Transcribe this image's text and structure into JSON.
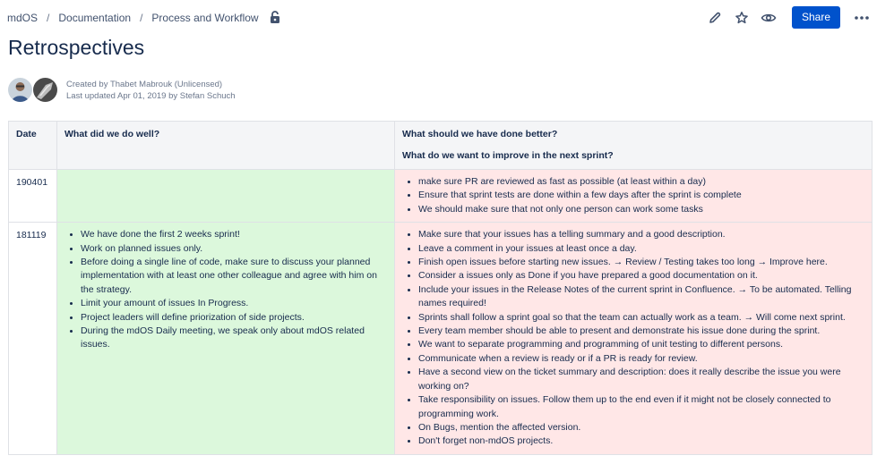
{
  "breadcrumb": {
    "items": [
      "mdOS",
      "Documentation",
      "Process and Workflow"
    ],
    "separator": "/"
  },
  "toolbar": {
    "share_label": "Share",
    "icons": [
      "edit-icon",
      "star-icon",
      "watch-icon",
      "more-icon"
    ],
    "accent": "#0052cc"
  },
  "page": {
    "title": "Retrospectives",
    "created_by": "Created by Thabet Mabrouk (Unlicensed)",
    "last_updated": "Last updated Apr 01, 2019 by Stefan Schuch"
  },
  "table": {
    "headers": {
      "date": "Date",
      "good": "What did we do well?",
      "bad_line1": "What should we have done better?",
      "bad_line2": "What do we want to improve in the next sprint?"
    },
    "colors": {
      "good": "#dcf8dc",
      "bad": "#ffe7e7",
      "header": "#f4f5f7"
    },
    "rows": [
      {
        "date": "190401",
        "good": [],
        "bad": [
          "make sure PR are reviewed as fast as possible (at least within a day)",
          "Ensure that sprint tests are done within a few days after the sprint is complete",
          "We should make sure that not only one person can work some tasks"
        ]
      },
      {
        "date": "181119",
        "good": [
          "We have done the first 2 weeks sprint!",
          "Work on planned issues only.",
          "Before doing a single line of code, make sure to discuss your planned implementation with at least one other colleague and agree with him on the strategy.",
          "Limit your amount of issues In Progress.",
          "Project leaders will define priorization of side projects.",
          "During the mdOS Daily meeting, we speak only about mdOS related issues."
        ],
        "bad": [
          "Make sure that your issues has a telling summary and a good description.",
          "Leave a comment in your issues at least once a day.",
          "Finish open issues before starting new issues. → Review / Testing takes too long → Improve here.",
          "Consider a issues only as Done if you have prepared a good documentation on it.",
          "Include your issues in the Release Notes of the current sprint in Confluence. → To be automated. Telling names required!",
          "Sprints shall follow a sprint goal so that the team can actually work as a team. → Will come next sprint.",
          "Every team member should be able to present and demonstrate his issue done during the sprint.",
          "We want to separate programming and programming of unit testing to different persons.",
          "Communicate when a review is ready or if a PR is ready for review.",
          "Have a second view on the ticket summary and description: does it really describe the issue you were working on?",
          "Take responsibility on issues. Follow them up to the end even if it might not be closely connected to programming work.",
          "On Bugs, mention the affected version.",
          "Don't forget non-mdOS projects."
        ]
      }
    ]
  }
}
